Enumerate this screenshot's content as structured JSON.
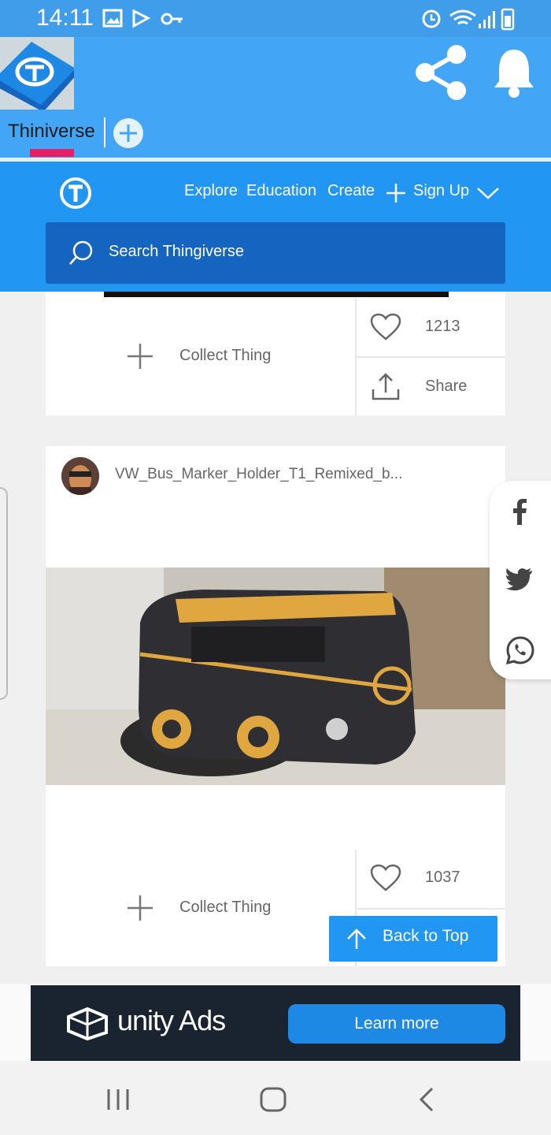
{
  "status_bar": {
    "time": "14:11"
  },
  "app_tab": {
    "label": "Thiniverse"
  },
  "site_nav": {
    "links": [
      "Explore",
      "Education",
      "Create",
      "Sign Up"
    ],
    "search_placeholder": "Search Thingiverse"
  },
  "card1": {
    "collect_label": "Collect Thing",
    "likes": "1213",
    "share_label": "Share"
  },
  "card2": {
    "title": "VW_Bus_Marker_Holder_T1_Remixed_b...",
    "collect_label": "Collect Thing",
    "likes": "1037"
  },
  "back_to_top": {
    "label": "Back to Top"
  },
  "ad": {
    "brand": "unity Ads",
    "cta": "Learn more"
  },
  "colors": {
    "status_bar": "#3f9de9",
    "app_bar": "#42a5f5",
    "site_nav": "#2196f3",
    "search": "#1565c0",
    "tab_indicator": "#e91e63"
  }
}
